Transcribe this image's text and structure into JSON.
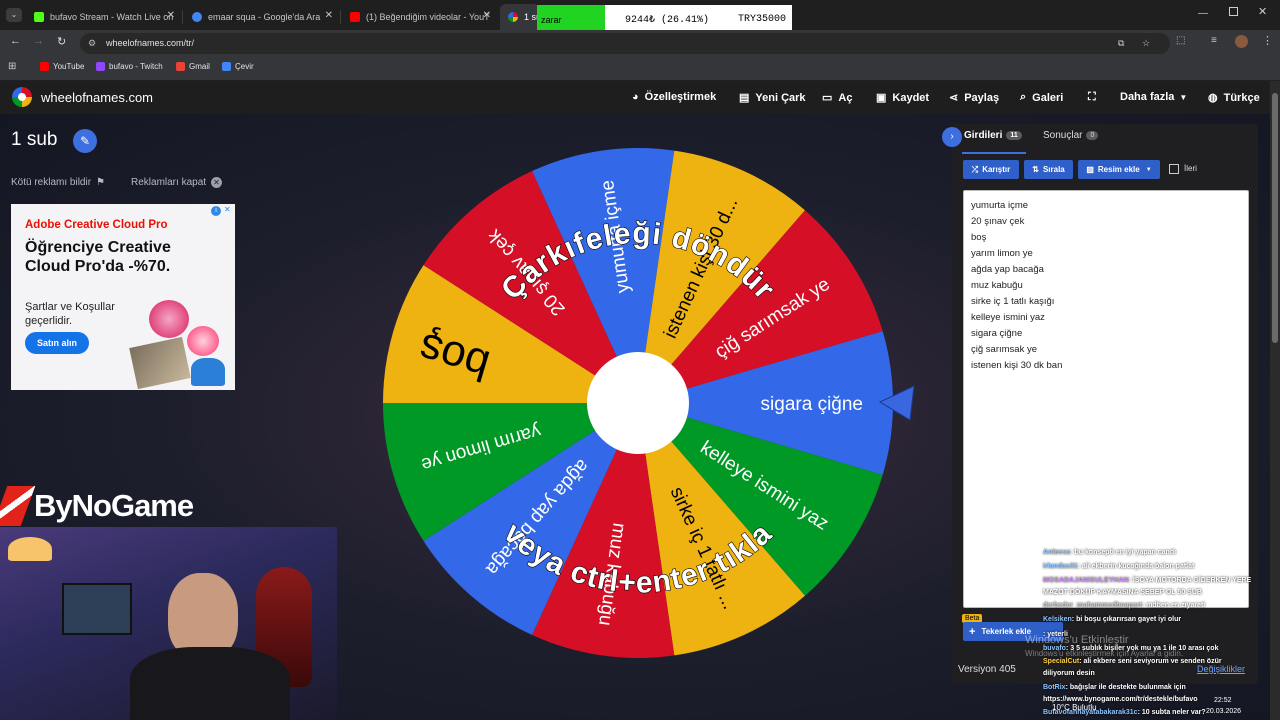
{
  "browser": {
    "tabs": [
      {
        "title": "bufavo Stream - Watch Live on",
        "color": "#53fc18"
      },
      {
        "title": "emaar squa - Google'da Ara",
        "color": "#4285f4"
      },
      {
        "title": "(1) Beğendiğim videolar - YouT",
        "color": "#ff0000"
      },
      {
        "title": "1 su",
        "color": "#e74c3c"
      }
    ],
    "url": "wheelofnames.com/tr/",
    "bookmarks": [
      {
        "label": "YouTube",
        "color": "#ff0000"
      },
      {
        "label": "bufavo - Twitch",
        "color": "#9146ff"
      },
      {
        "label": "Gmail",
        "color": "#ea4335"
      },
      {
        "label": "Çevir",
        "color": "#4285f4"
      }
    ]
  },
  "overlay": {
    "loss_label": "zarar",
    "loss_value": "9244₺ (26.41%)",
    "target": "TRY35000",
    "brand": "ByNoGame"
  },
  "site": {
    "logo": "wheelofnames.com",
    "nav": [
      {
        "label": "Özelleştirmek",
        "icon": "palette-icon"
      },
      {
        "label": "Yeni Çark",
        "icon": "file-icon"
      },
      {
        "label": "Aç",
        "icon": "folder-icon"
      },
      {
        "label": "Kaydet",
        "icon": "save-icon"
      },
      {
        "label": "Paylaş",
        "icon": "share-icon"
      },
      {
        "label": "Galeri",
        "icon": "search-icon"
      },
      {
        "label": "",
        "icon": "fullscreen-icon"
      },
      {
        "label": "Daha fazla",
        "icon": "chevron-down-icon"
      },
      {
        "label": "Türkçe",
        "icon": "globe-icon"
      }
    ]
  },
  "page": {
    "title": "1 sub",
    "report_ad": "Kötü reklamı bildir",
    "close_ad": "Reklamları kapat"
  },
  "ad": {
    "brand": "Adobe Creative Cloud Pro",
    "headline": "Öğrenciye Creative Cloud Pro'da -%70.",
    "terms": "Şartlar ve Koşullar geçerlidir.",
    "cta": "Satın alın"
  },
  "wheel": {
    "center_text_top": "Çarkıfeleği döndür",
    "center_text_bottom": "veya ctrl+enter tıkla",
    "segments": [
      {
        "label": "sigara çiğne",
        "color": "#3369e8"
      },
      {
        "label": "kelleye ismini yaz",
        "color": "#009925"
      },
      {
        "label": "sirke iç 1 tatlı ...",
        "color": "#eeb211"
      },
      {
        "label": "muz kabuğu",
        "color": "#d50f25"
      },
      {
        "label": "ağda yap bacağa",
        "color": "#3369e8"
      },
      {
        "label": "yarım limon ye",
        "color": "#009925"
      },
      {
        "label": "boş",
        "color": "#eeb211"
      },
      {
        "label": "20 şınav çek",
        "color": "#d50f25"
      },
      {
        "label": "yumurta içme",
        "color": "#3369e8"
      },
      {
        "label": "istenen kişi 30 d...",
        "color": "#eeb211"
      },
      {
        "label": "çiğ sarımsak ye",
        "color": "#d50f25"
      }
    ]
  },
  "panel": {
    "tab_entries": "Girdileri",
    "entries_count": "11",
    "tab_results": "Sonuçlar",
    "results_count": "0",
    "shuffle": "Karıştır",
    "sort": "Sırala",
    "add_image": "Resim ekle",
    "advanced": "İleri",
    "entries": [
      "yumurta içme",
      "20 şınav çek",
      "boş",
      "yarım limon ye",
      "ağda yap bacağa",
      "muz kabuğu",
      "sirke iç 1 tatlı kaşığı",
      "kelleye ismini yaz",
      "sigara çiğne",
      "çiğ sarımsak ye",
      "istenen kişi 30 dk ban"
    ],
    "beta": "Beta",
    "add_wheels": "Tekerlek ekle",
    "version": "Versiyon 405",
    "changes": "Değişiklikler"
  },
  "chat": [
    {
      "user": "Anteess",
      "msg": ": bu konsepti en iyi yapan candı",
      "color": "#8ec5ff"
    },
    {
      "user": "irlandas31",
      "msg": ": ali ekberin kucağında balon patlat",
      "color": "#8ec5ff"
    },
    {
      "user": "MOSADAJANISULEYHAN",
      "msg": ": İSOYA MOTORDA GİDERKEN YERE",
      "color": "#d68cff"
    },
    {
      "user": "",
      "msg": "MAZOT DÖKÜP KAYMASINA SEBEP OL 50 SUB",
      "color": "#fff"
    },
    {
      "user": "derbeder_muhammedbnapart",
      "msg": ": mdben en ziyareti",
      "color": "#c9c9c9"
    },
    {
      "user": "Kelsiken",
      "msg": ": bi boşu çıkarırsan gayet iyi olur",
      "color": "#8ec5ff"
    },
    {
      "user": "",
      "msg": ": yeterli",
      "color": "#fff"
    },
    {
      "user": "buvafo",
      "msg": ": 3 5 sublık bişiler yok mu ya 1 ile 10 arası çok",
      "color": "#8ec5ff"
    },
    {
      "user": "SpecialCut",
      "msg": ": ali ekbere seni seviyorum ve senden özür",
      "color": "#ffd23c"
    },
    {
      "user": "",
      "msg": "diliyorum desin",
      "color": "#fff"
    },
    {
      "user": "BotRix",
      "msg": ": bağışlar ile destekte bulunmak için",
      "color": "#8ec5ff"
    },
    {
      "user": "",
      "msg": "https://www.bynogame.com/tr/destekle/bufavo",
      "color": "#fff"
    },
    {
      "user": "Bufavofanhayatabakarak31c",
      "msg": ": 10 subta neler var?",
      "color": "#8ec5ff"
    }
  ],
  "windows": {
    "activate": "Windows'u Etkinleştir",
    "activate_sub": "Windows'u etkinleştirmek için Ayarlar'a gidin.",
    "weather": "10°C  Bulutlu",
    "time": "22:52",
    "date": "20.03.2026"
  }
}
